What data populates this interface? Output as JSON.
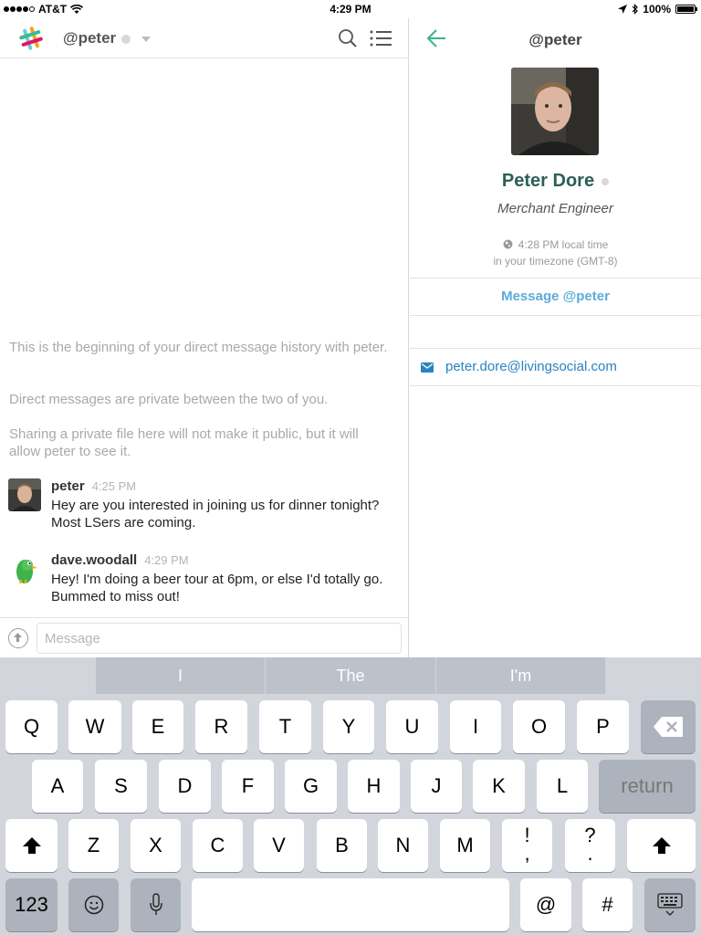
{
  "status_bar": {
    "carrier": "AT&T",
    "time": "4:29 PM",
    "battery": "100%"
  },
  "left": {
    "channel_title": "@peter",
    "intro": [
      "This is the beginning of your direct message history with peter.",
      "Direct messages are private between the two of you.",
      "Sharing a private file here will not make it public, but it will allow peter to see it."
    ],
    "messages": [
      {
        "author": "peter",
        "time": "4:25 PM",
        "text": "Hey are you interested in joining us for dinner tonight? Most LSers are coming."
      },
      {
        "author": "dave.woodall",
        "time": "4:29 PM",
        "text": "Hey! I'm doing a beer tour at 6pm, or else I'd totally go. Bummed to miss out!"
      }
    ],
    "composer_placeholder": "Message"
  },
  "right": {
    "title": "@peter",
    "name": "Peter Dore",
    "role": "Merchant Engineer",
    "local_time": "4:28 PM local time",
    "timezone": "in your timezone (GMT-8)",
    "message_button": "Message @peter",
    "email": "peter.dore@livingsocial.com"
  },
  "keyboard": {
    "suggestions": [
      "I",
      "The",
      "I'm"
    ],
    "row1": [
      "Q",
      "W",
      "E",
      "R",
      "T",
      "Y",
      "U",
      "I",
      "O",
      "P"
    ],
    "row2": [
      "A",
      "S",
      "D",
      "F",
      "G",
      "H",
      "J",
      "K",
      "L"
    ],
    "return_label": "return",
    "row3": [
      "Z",
      "X",
      "C",
      "V",
      "B",
      "N",
      "M"
    ],
    "punct1": {
      "top": "!",
      "bottom": ","
    },
    "punct2": {
      "top": "?",
      "bottom": "."
    },
    "numbers_label": "123",
    "at_label": "@",
    "hash_label": "#"
  },
  "colors": {
    "profile_name": "#2c5f56",
    "link": "#2a83c0",
    "message_button": "#5cacd8",
    "back_arrow": "#3fae8f"
  }
}
